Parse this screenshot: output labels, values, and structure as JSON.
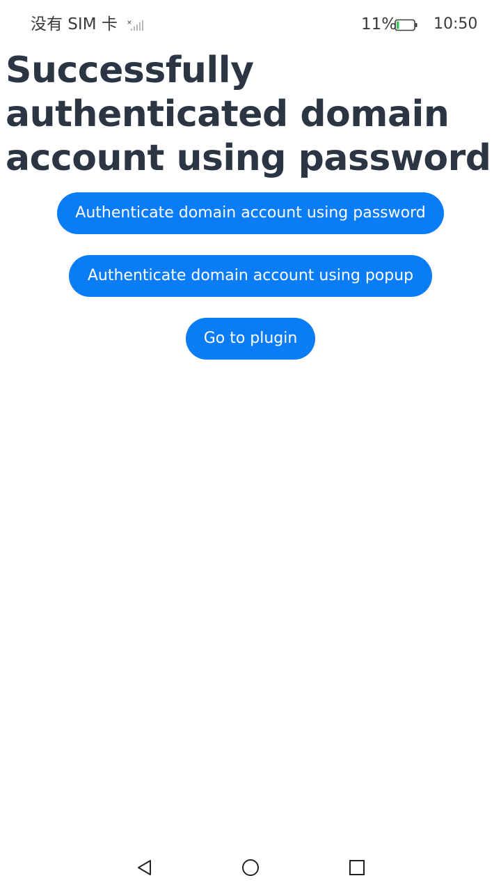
{
  "status_bar": {
    "carrier": "没有 SIM 卡",
    "signal_icon": "signal-off-icon",
    "battery_percent": "11%",
    "battery_icon": "battery-low-icon",
    "battery_color": "#35c759",
    "time": "10:50"
  },
  "main": {
    "title": "Successfully authenticated domain account using password",
    "buttons": [
      {
        "label": "Authenticate domain account using password"
      },
      {
        "label": "Authenticate domain account using popup"
      },
      {
        "label": "Go to plugin"
      }
    ]
  },
  "nav_bar": {
    "back_icon": "back-triangle-icon",
    "home_icon": "home-circle-icon",
    "recent_icon": "recent-square-icon"
  },
  "colors": {
    "accent": "#0a7cf5",
    "title_text": "#2b3544",
    "background": "#ffffff"
  }
}
